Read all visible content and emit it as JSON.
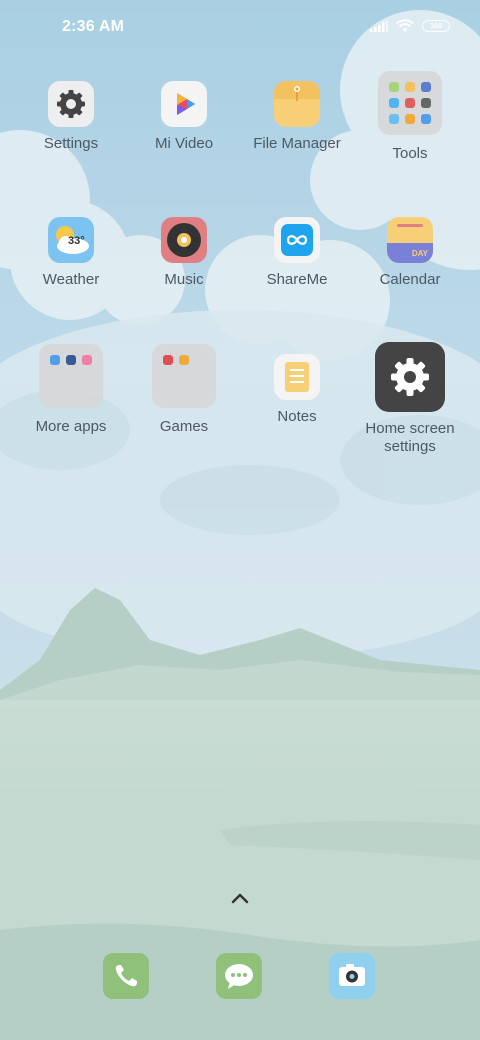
{
  "status_bar": {
    "time": "2:36 AM",
    "battery_level": "100",
    "icons": [
      "signal-icon",
      "wifi-icon",
      "battery-icon"
    ]
  },
  "apps": [
    {
      "label": "Settings",
      "icon": "gear-icon"
    },
    {
      "label": "Mi Video",
      "icon": "play-icon"
    },
    {
      "label": "File Manager",
      "icon": "folder-icon"
    },
    {
      "label": "Tools",
      "icon": "tools-folder-icon"
    },
    {
      "label": "Weather",
      "icon": "weather-icon",
      "temperature": "33°"
    },
    {
      "label": "Music",
      "icon": "vinyl-icon"
    },
    {
      "label": "ShareMe",
      "icon": "infinity-icon"
    },
    {
      "label": "Calendar",
      "icon": "calendar-icon",
      "badge": "DAY"
    },
    {
      "label": "More apps",
      "icon": "more-apps-folder-icon"
    },
    {
      "label": "Games",
      "icon": "games-folder-icon"
    },
    {
      "label": "Notes",
      "icon": "notes-icon"
    },
    {
      "label": "Home screen settings",
      "icon": "home-settings-gear-icon"
    }
  ],
  "dock": [
    {
      "name": "phone",
      "icon": "phone-icon",
      "color": "#8fc17a"
    },
    {
      "name": "messages",
      "icon": "message-icon",
      "color": "#8fc17a"
    },
    {
      "name": "camera",
      "icon": "camera-icon",
      "color": "#8fd0ef"
    }
  ],
  "app_drawer_handle": "chevron-up-icon"
}
